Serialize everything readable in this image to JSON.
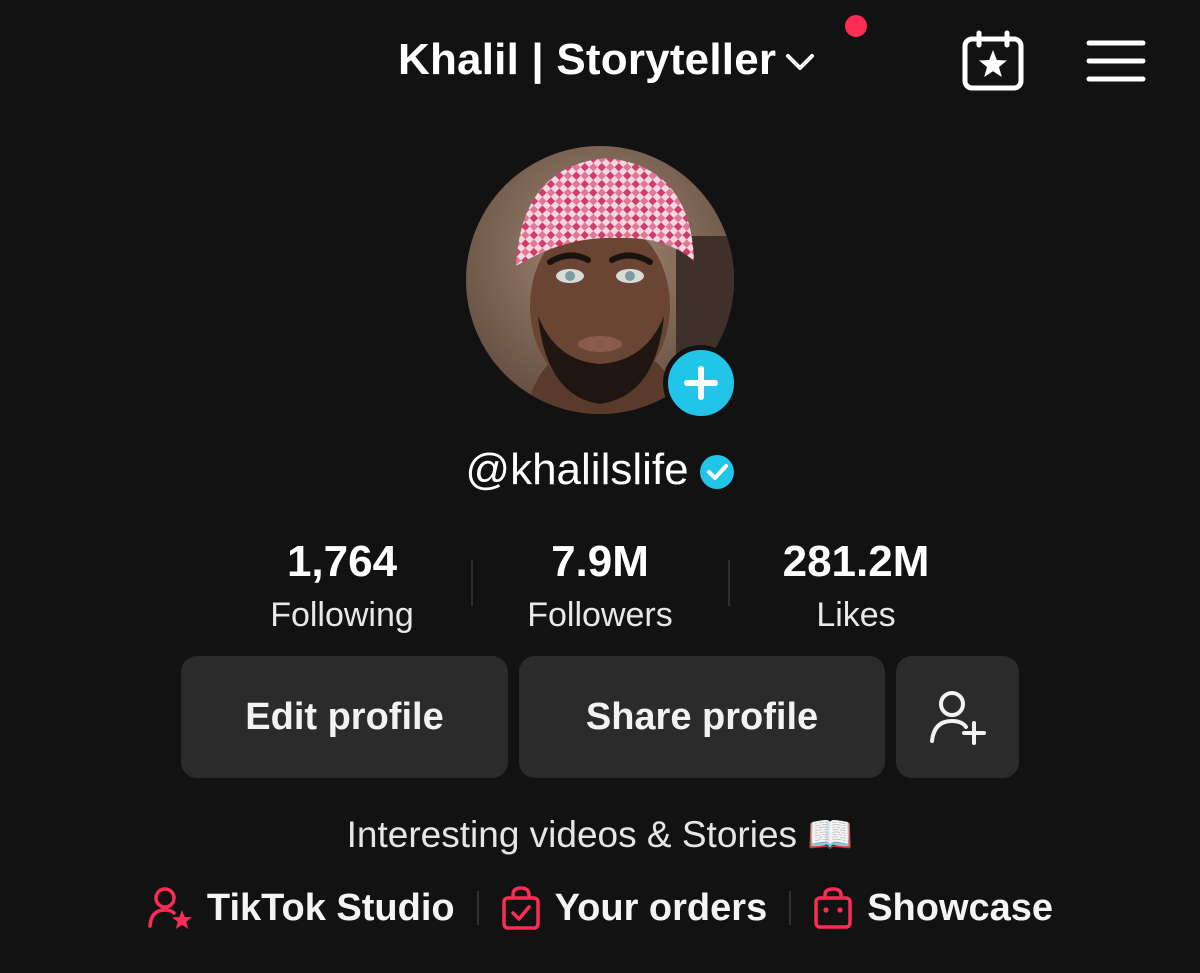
{
  "header": {
    "display_name": "Khalil | Storyteller",
    "chevron_icon": "chevron-down-icon",
    "notification_color": "#fe2c55",
    "calendar_icon": "calendar-star-icon",
    "menu_icon": "hamburger-menu-icon"
  },
  "profile": {
    "avatar_icon": "avatar-photo",
    "add_icon": "plus-icon",
    "add_color": "#20c5e8",
    "username": "@khalilslife",
    "verified_icon": "verified-check-icon"
  },
  "stats": [
    {
      "value": "1,764",
      "label": "Following"
    },
    {
      "value": "7.9M",
      "label": "Followers"
    },
    {
      "value": "281.2M",
      "label": "Likes"
    }
  ],
  "actions": {
    "edit_profile": "Edit profile",
    "share_profile": "Share profile",
    "add_friend_icon": "add-person-icon"
  },
  "bio": "Interesting videos & Stories 📖",
  "links": [
    {
      "label": "TikTok Studio",
      "icon": "person-star-icon"
    },
    {
      "label": "Your orders",
      "icon": "shopping-bag-check-icon"
    },
    {
      "label": "Showcase",
      "icon": "shopping-bag-icon"
    }
  ],
  "accent_color": "#fe2c55"
}
